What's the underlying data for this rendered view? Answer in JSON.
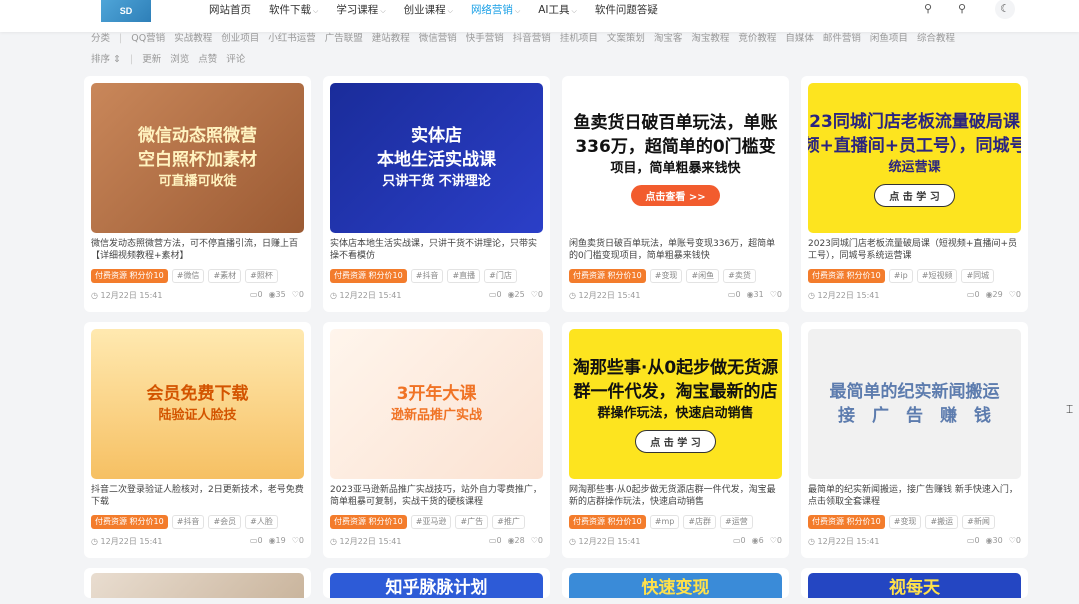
{
  "header": {
    "logo_text": "SD",
    "nav": [
      {
        "label": "网站首页",
        "has_chevron": false,
        "active": false
      },
      {
        "label": "软件下载",
        "has_chevron": true,
        "active": false
      },
      {
        "label": "学习课程",
        "has_chevron": true,
        "active": false
      },
      {
        "label": "创业课程",
        "has_chevron": true,
        "active": false
      },
      {
        "label": "网络营销",
        "has_chevron": true,
        "active": true
      },
      {
        "label": "AI工具",
        "has_chevron": true,
        "active": false
      },
      {
        "label": "软件问题答疑",
        "has_chevron": false,
        "active": false
      }
    ],
    "tools": [
      "bulb-icon",
      "search-icon",
      "moon-icon"
    ]
  },
  "filters": {
    "category_label": "分类",
    "categories": [
      "QQ营销",
      "实战教程",
      "创业项目",
      "小红书运营",
      "广告联盟",
      "建站教程",
      "微信营销",
      "快手营销",
      "抖音营销",
      "挂机项目",
      "文案策划",
      "淘宝客",
      "淘宝教程",
      "竞价教程",
      "自媒体",
      "邮件营销",
      "闲鱼项目",
      "综合教程"
    ],
    "sort_label": "排序",
    "sort_chevron": "⇕",
    "sorts": [
      "更新",
      "浏览",
      "点赞",
      "评论"
    ]
  },
  "colors": {
    "accent": "#1aa0e6",
    "price_badge": "#f37c2c"
  },
  "cards": [
    {
      "thumb": {
        "bg": "linear-gradient(135deg,#c9875a,#9b5a33)",
        "color": "#fff3c0",
        "lines": [
          "微信动态照微营",
          "空白照杯加素材",
          "可直播可收徒"
        ],
        "button": ""
      },
      "title": "微信发动态照微营方法，可不停直播引流，日赚上百【详细视频教程+素材】",
      "price": "付费资源 积分价10",
      "tags": [
        "#微信",
        "#素材",
        "#照杯"
      ],
      "date": "12月22日 15:41",
      "comments": "0",
      "views": "35",
      "likes": "0"
    },
    {
      "thumb": {
        "bg": "linear-gradient(135deg,#1a2c9a,#2b3fc8)",
        "color": "#fff",
        "lines": [
          "实体店",
          "本地生活实战课",
          "只讲干货 不讲理论"
        ],
        "button": ""
      },
      "title": "实体店本地生活实战课，只讲干货不讲理论，只带实操不看模仿",
      "price": "付费资源 积分价10",
      "tags": [
        "#抖音",
        "#直播",
        "#门店"
      ],
      "date": "12月22日 15:41",
      "comments": "0",
      "views": "25",
      "likes": "0"
    },
    {
      "thumb": {
        "bg": "#ffffff",
        "color": "#111",
        "lines": [
          "鱼卖货日破百单玩法，单账",
          "336万，超简单的0门槛变",
          "项目，简单粗暴来钱快"
        ],
        "button": "点击查看 >>"
      },
      "title": "闲鱼卖货日破百单玩法，单账号变现336万，超简单的0门槛变现项目，简单粗暴来钱快",
      "price": "付费资源 积分价10",
      "tags": [
        "#变现",
        "#闲鱼",
        "#卖货"
      ],
      "date": "12月22日 15:41",
      "comments": "0",
      "views": "31",
      "likes": "0"
    },
    {
      "thumb": {
        "bg": "#fde41f",
        "color": "#2a2480",
        "lines": [
          "23同城门店老板流量破局课",
          "频+直播间+员工号），同城号",
          "统运营课"
        ],
        "button": "点 击 学 习"
      },
      "title": "2023同城门店老板流量破局课（短视频+直播间+员工号），同城号系统运营课",
      "price": "付费资源 积分价10",
      "tags": [
        "#ip",
        "#短视频",
        "#同城"
      ],
      "date": "12月22日 15:41",
      "comments": "0",
      "views": "29",
      "likes": "0"
    },
    {
      "thumb": {
        "bg": "linear-gradient(180deg,#ffe9b0,#f6c063)",
        "color": "#d35400",
        "lines": [
          "会员免费下载",
          "",
          "陆验证人脸技"
        ],
        "button": ""
      },
      "title": "抖音二次登录验证人脸核对，2日更新技术，老号免费下载",
      "price": "付费资源 积分价10",
      "tags": [
        "#抖音",
        "#会员",
        "#人脸"
      ],
      "date": "12月22日 15:41",
      "comments": "0",
      "views": "19",
      "likes": "0"
    },
    {
      "thumb": {
        "bg": "linear-gradient(135deg,#fff5ec,#fbe2d2)",
        "color": "#f07325",
        "lines": [
          "3开年大课",
          "",
          "逊新品推广实战"
        ],
        "button": ""
      },
      "title": "2023亚马逊新品推广实战技巧，站外自力零费推广，简单粗暴可复制，实战干货的硬核课程",
      "price": "付费资源 积分价10",
      "tags": [
        "#亚马逊",
        "#广告",
        "#推广"
      ],
      "date": "12月22日 15:41",
      "comments": "0",
      "views": "28",
      "likes": "0"
    },
    {
      "thumb": {
        "bg": "#fde41f",
        "color": "#111",
        "lines": [
          "淘那些事·从0起步做无货源",
          "群一件代发，淘宝最新的店",
          "群操作玩法，快速启动销售"
        ],
        "button": "点 击 学 习"
      },
      "title": "网淘那些事·从0起步做无货源店群一件代发，淘宝最新的店群操作玩法，快速启动销售",
      "price": "付费资源 积分价10",
      "tags": [
        "#mp",
        "#店群",
        "#运营"
      ],
      "date": "12月22日 15:41",
      "comments": "0",
      "views": "6",
      "likes": "0"
    },
    {
      "thumb": {
        "bg": "#f1f1f1",
        "color": "#5d7cae",
        "lines": [
          "最简单的纪实新闻搬运",
          "接　广　告　赚　钱",
          ""
        ],
        "button": ""
      },
      "title": "最简单的纪实新闻搬运，接广告赚钱 新手快速入门，点击领取全套课程",
      "price": "付费资源 积分价10",
      "tags": [
        "#变现",
        "#搬运",
        "#新闻"
      ],
      "date": "12月22日 15:41",
      "comments": "0",
      "views": "30",
      "likes": "0"
    },
    {
      "thumb": {
        "bg": "linear-gradient(135deg,#e9ddd0,#c9b49c)",
        "color": "#333",
        "lines": [],
        "button": ""
      },
      "title": "",
      "price": "",
      "tags": [],
      "date": "",
      "comments": "",
      "views": "",
      "likes": ""
    },
    {
      "thumb": {
        "bg": "#2d5bd7",
        "color": "#fff",
        "lines": [
          "知乎脉脉计划"
        ],
        "button": ""
      },
      "title": "",
      "price": "",
      "tags": [],
      "date": "",
      "comments": "",
      "views": "",
      "likes": ""
    },
    {
      "thumb": {
        "bg": "#3a8bd8",
        "color": "#ffe14a",
        "lines": [
          "快速变现"
        ],
        "button": ""
      },
      "title": "",
      "price": "",
      "tags": [],
      "date": "",
      "comments": "",
      "views": "",
      "likes": ""
    },
    {
      "thumb": {
        "bg": "#2446c2",
        "color": "#ffe14a",
        "lines": [
          "视每天"
        ],
        "button": ""
      },
      "title": "",
      "price": "",
      "tags": [],
      "date": "",
      "comments": "",
      "views": "",
      "likes": ""
    }
  ]
}
